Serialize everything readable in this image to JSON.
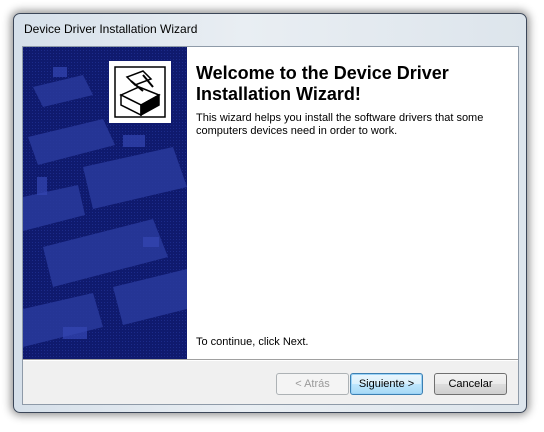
{
  "window": {
    "title": "Device Driver Installation Wizard"
  },
  "main": {
    "heading": "Welcome to the Device Driver Installation Wizard!",
    "description": "This wizard helps you install the software drivers that some computers devices need in order to work.",
    "continue_text": "To continue, click Next."
  },
  "buttons": {
    "back_label": "< Atrás",
    "next_label": "Siguiente >",
    "cancel_label": "Cancelar"
  },
  "banner": {
    "icon": "hardware-install-icon",
    "background_color": "#0f1a6e"
  }
}
